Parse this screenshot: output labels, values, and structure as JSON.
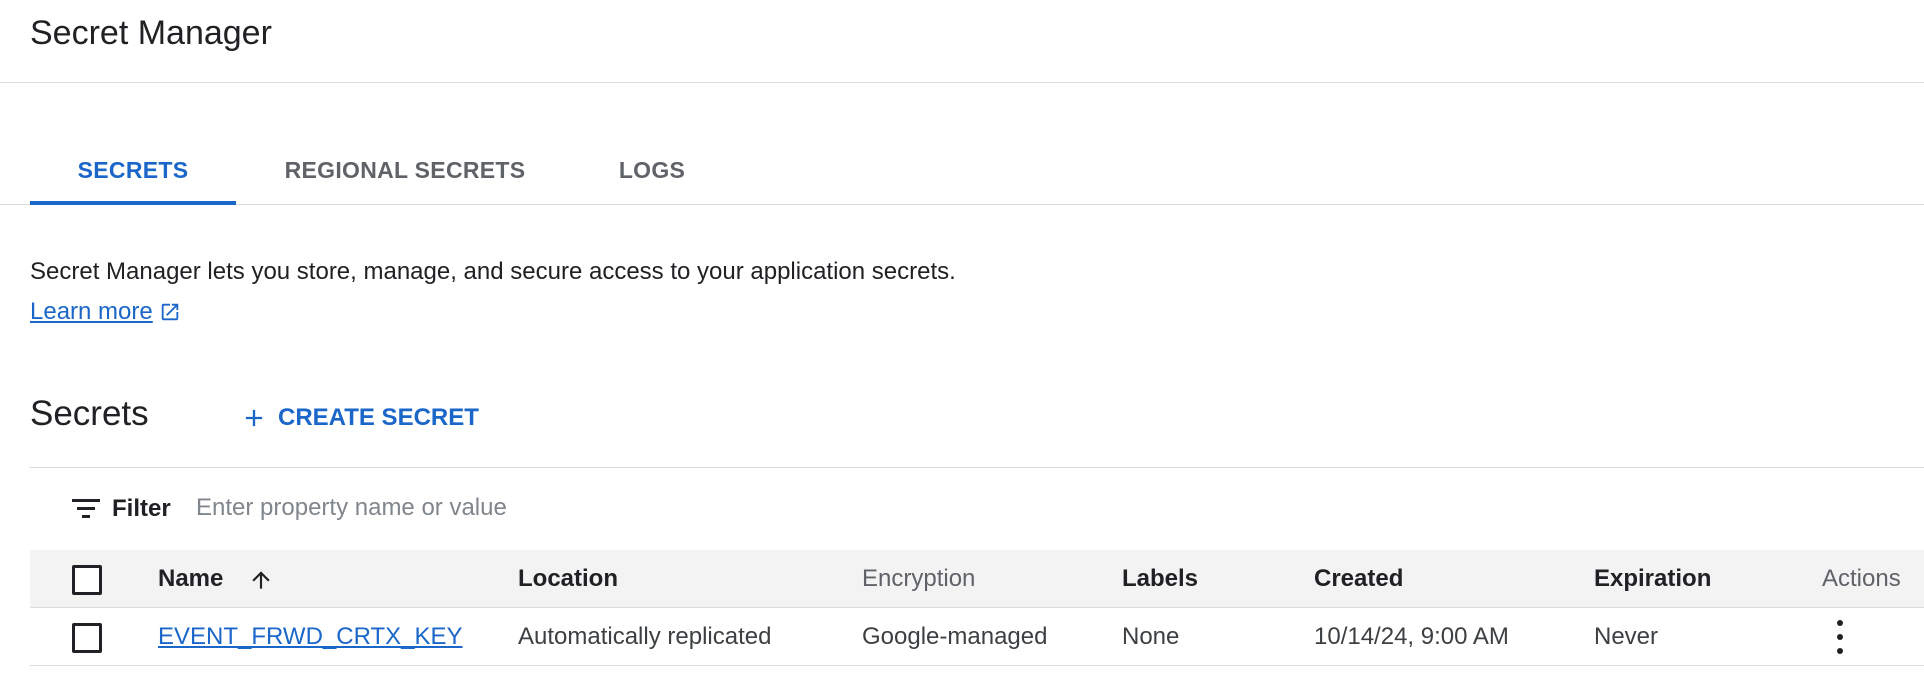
{
  "header": {
    "title": "Secret Manager"
  },
  "tabs": [
    {
      "label": "SECRETS",
      "active": true
    },
    {
      "label": "REGIONAL SECRETS",
      "active": false
    },
    {
      "label": "LOGS",
      "active": false
    }
  ],
  "intro": {
    "description": "Secret Manager lets you store, manage, and secure access to your application secrets.",
    "learn_more": "Learn more"
  },
  "secrets_section": {
    "title": "Secrets",
    "create_button": "CREATE SECRET"
  },
  "filter": {
    "label": "Filter",
    "placeholder": "Enter property name or value",
    "value": ""
  },
  "table": {
    "columns": {
      "name": "Name",
      "location": "Location",
      "encryption": "Encryption",
      "labels": "Labels",
      "created": "Created",
      "expiration": "Expiration",
      "actions": "Actions"
    },
    "sort": {
      "column": "name",
      "direction": "ascending"
    },
    "rows": [
      {
        "name": "EVENT_FRWD_CRTX_KEY",
        "location": "Automatically replicated",
        "encryption": "Google-managed",
        "labels": "None",
        "created": "10/14/24, 9:00 AM",
        "expiration": "Never"
      }
    ]
  },
  "colors": {
    "accent": "#1a66c9",
    "text": "#202124",
    "muted": "#5f6368",
    "divider": "#dadce0",
    "header_bg": "#f3f3f3"
  },
  "icons": {
    "external_link": "external-link-icon",
    "add": "plus-icon",
    "filter": "filter-icon",
    "sort": "arrow-up-icon",
    "row_actions": "more-vert-icon"
  }
}
